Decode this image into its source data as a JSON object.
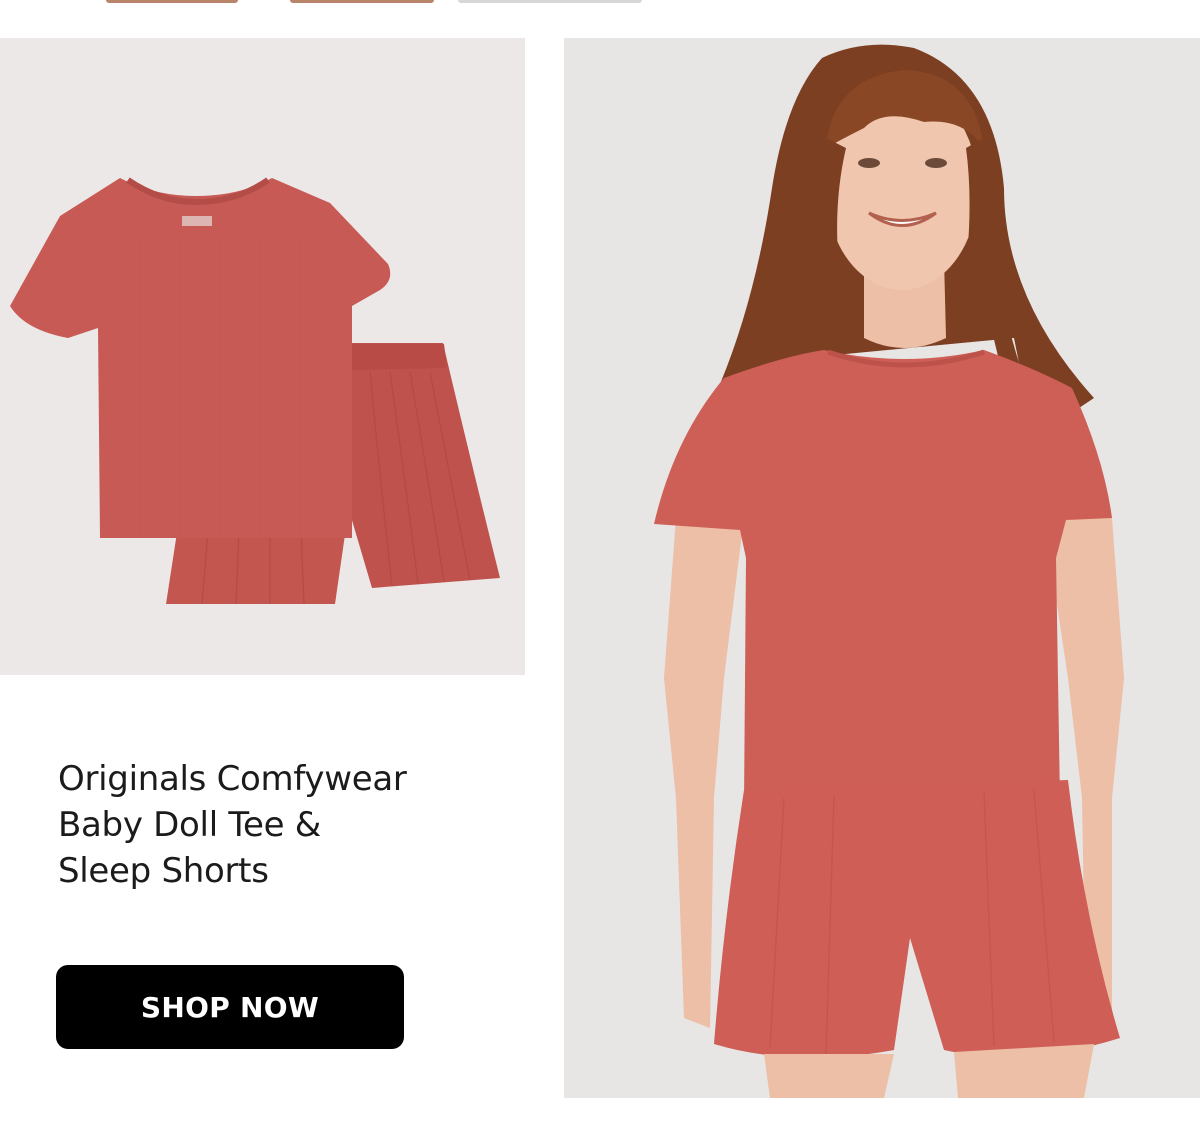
{
  "product": {
    "title": "Originals Comfywear\nBaby Doll Tee &\nSleep Shorts"
  },
  "cta": {
    "label": "SHOP NOW"
  },
  "images": {
    "flat_lay": {
      "icon": "pajama-set-flat-lay-image"
    },
    "model": {
      "icon": "model-wearing-pajama-set-image"
    }
  },
  "colors": {
    "garment": "#c85a55",
    "flat_panel_bg": "#ece8e7",
    "model_panel_bg": "#e8e5e5",
    "button_bg": "#000000",
    "button_text": "#ffffff",
    "title_text": "#1b1b1b"
  }
}
